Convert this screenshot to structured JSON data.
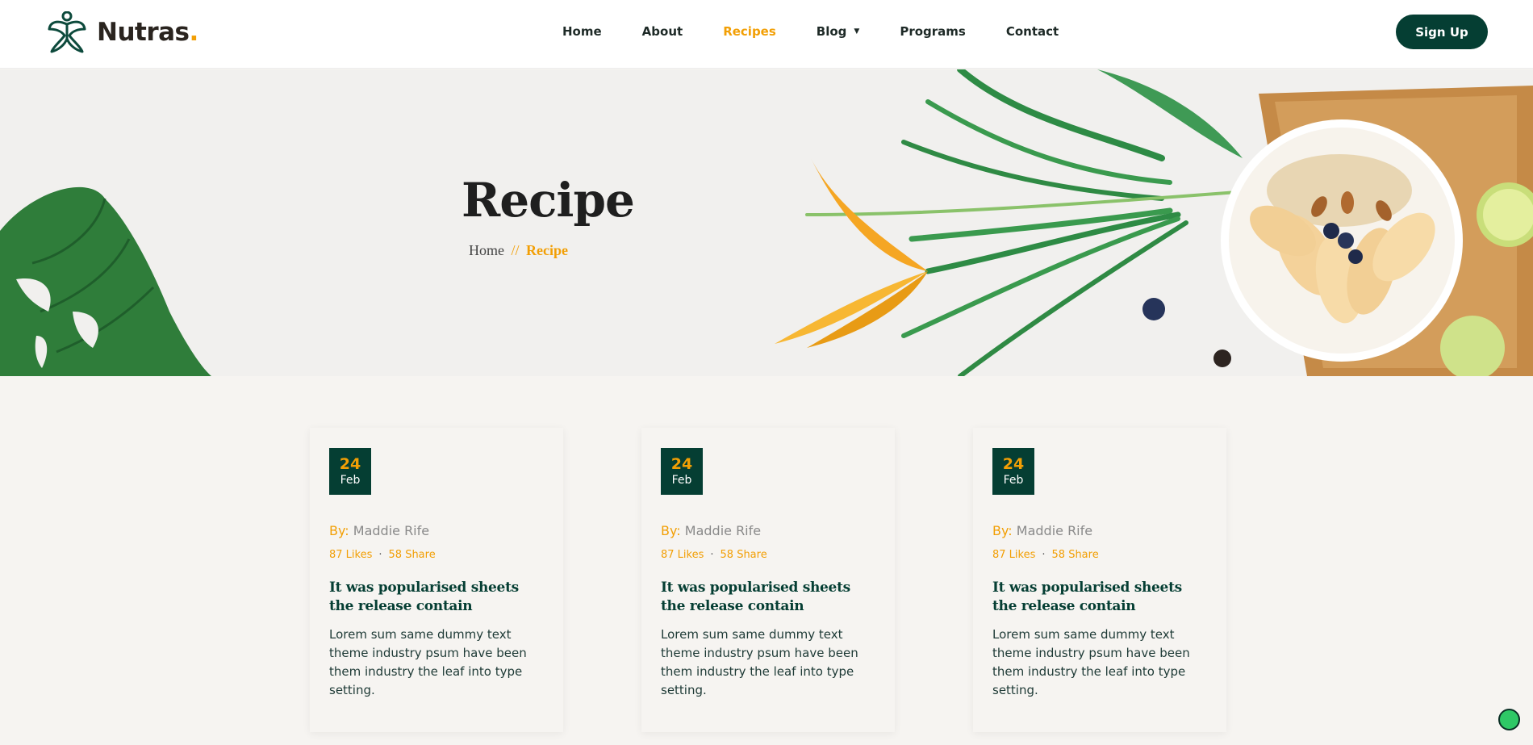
{
  "brand": {
    "name": "Nutras",
    "dot": ".",
    "accent": "#f29f05",
    "primary": "#053e33"
  },
  "nav": {
    "items": [
      {
        "label": "Home"
      },
      {
        "label": "About"
      },
      {
        "label": "Recipes"
      },
      {
        "label": "Blog"
      },
      {
        "label": "Programs"
      },
      {
        "label": "Contact"
      }
    ],
    "active": "Recipes",
    "blog_caret": "▼"
  },
  "header": {
    "signup_label": "Sign Up"
  },
  "hero": {
    "title": "Recipe",
    "breadcrumb": {
      "home": "Home",
      "separator": "//",
      "current": "Recipe"
    }
  },
  "cards": [
    {
      "day": "24",
      "month": "Feb",
      "by_label": "By:",
      "author": "Maddie Rife",
      "likes": "87 Likes",
      "dot": "·",
      "shares": "58 Share",
      "title": "It was popularised sheets the release contain",
      "text": "Lorem sum same dummy text theme industry psum have been them industry the leaf into type setting."
    },
    {
      "day": "24",
      "month": "Feb",
      "by_label": "By:",
      "author": "Maddie Rife",
      "likes": "87 Likes",
      "dot": "·",
      "shares": "58 Share",
      "title": "It was popularised sheets the release contain",
      "text": "Lorem sum same dummy text theme industry psum have been them industry the leaf into type setting."
    },
    {
      "day": "24",
      "month": "Feb",
      "by_label": "By:",
      "author": "Maddie Rife",
      "likes": "87 Likes",
      "dot": "·",
      "shares": "58 Share",
      "title": "It was popularised sheets the release contain",
      "text": "Lorem sum same dummy text theme industry psum have been them industry the leaf into type setting."
    }
  ],
  "icons": {
    "logo": "leaf-person-logo-icon",
    "fab": "chat-bubble-icon"
  }
}
